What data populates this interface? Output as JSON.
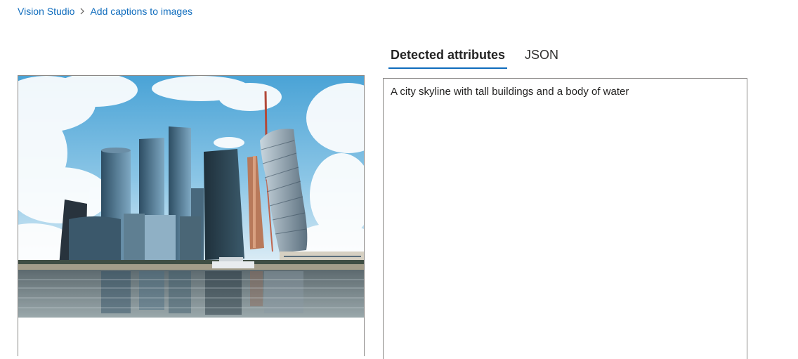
{
  "breadcrumb": {
    "items": [
      {
        "label": "Vision Studio"
      },
      {
        "label": "Add captions to images"
      }
    ]
  },
  "tabs": [
    {
      "label": "Detected attributes",
      "active": true
    },
    {
      "label": "JSON",
      "active": false
    }
  ],
  "result": {
    "caption": "A city skyline with tall buildings and a body of water"
  },
  "image": {
    "subject": "city skyline with skyscrapers and river"
  },
  "colors": {
    "link": "#0f6cbd",
    "tab_underline": "#0f6cbd",
    "border": "#8a8886"
  }
}
